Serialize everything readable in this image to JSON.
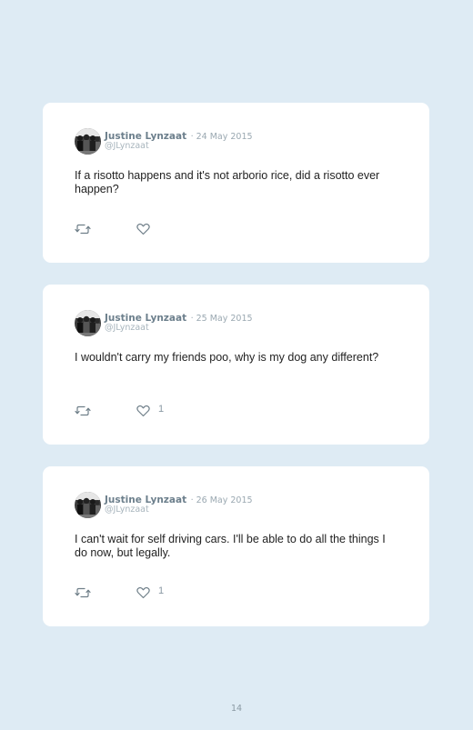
{
  "tweets": [
    {
      "name": "Justine Lynzaat",
      "date": "· 24 May 2015",
      "handle": "@JLynzaat",
      "text": "If a risotto happens and it's not arborio rice, did a risotto ever happen?",
      "likes": ""
    },
    {
      "name": "Justine Lynzaat",
      "date": "· 25 May 2015",
      "handle": "@JLynzaat",
      "text": "I wouldn't carry my friends poo, why is my dog any different?",
      "likes": "1"
    },
    {
      "name": "Justine Lynzaat",
      "date": "· 26 May 2015",
      "handle": "@JLynzaat",
      "text": "I can't wait for self driving cars. I'll be able to do all the things I do now, but legally.",
      "likes": "1"
    }
  ],
  "page_number": "14",
  "colors": {
    "background": "#deebf4",
    "card": "#ffffff",
    "name": "#6c7f8c",
    "meta": "#9aa8b1",
    "icon": "#6f7f89"
  },
  "icons": [
    "avatar",
    "retweet-icon",
    "heart-icon"
  ]
}
